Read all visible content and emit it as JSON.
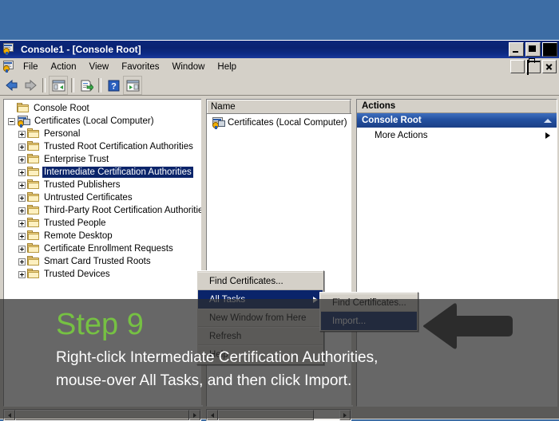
{
  "desktop": {
    "background_color": "#3d6da5"
  },
  "window": {
    "title": "Console1 - [Console Root]",
    "icon": "mmc-console-icon",
    "buttons": {
      "minimize": "Minimize",
      "maximize": "Maximize",
      "close": "Close"
    },
    "mdi_buttons": {
      "minimize": "Minimize",
      "restore": "Restore",
      "close": "Close"
    }
  },
  "menubar": {
    "icon": "mmc-console-icon",
    "items": [
      {
        "label": "File"
      },
      {
        "label": "Action"
      },
      {
        "label": "View"
      },
      {
        "label": "Favorites"
      },
      {
        "label": "Window"
      },
      {
        "label": "Help"
      }
    ]
  },
  "toolbar": {
    "items": [
      {
        "name": "back-button",
        "icon": "arrow-left-icon"
      },
      {
        "name": "forward-button",
        "icon": "arrow-right-icon"
      },
      {
        "name": "show-hide-tree-button",
        "icon": "console-tree-icon"
      },
      {
        "name": "export-list-button",
        "icon": "export-list-icon"
      },
      {
        "name": "help-button",
        "icon": "question-mark-icon"
      },
      {
        "name": "show-action-pane-button",
        "icon": "action-pane-icon"
      }
    ]
  },
  "tree": {
    "root": {
      "label": "Console Root",
      "icon": "folder-icon"
    },
    "node": {
      "label": "Certificates (Local Computer)",
      "icon": "certificate-computer-icon",
      "expander": "minus"
    },
    "children": [
      {
        "label": "Personal"
      },
      {
        "label": "Trusted Root Certification Authorities"
      },
      {
        "label": "Enterprise Trust"
      },
      {
        "label": "Intermediate Certification Authorities",
        "selected": true
      },
      {
        "label": "Trusted Publishers"
      },
      {
        "label": "Untrusted Certificates"
      },
      {
        "label": "Third-Party Root Certification Authorities"
      },
      {
        "label": "Trusted People"
      },
      {
        "label": "Remote Desktop"
      },
      {
        "label": "Certificate Enrollment Requests"
      },
      {
        "label": "Smart Card Trusted Roots"
      },
      {
        "label": "Trusted Devices"
      }
    ]
  },
  "list": {
    "columns": [
      "Name"
    ],
    "rows": [
      {
        "name": "Certificates (Local Computer)",
        "icon": "certificate-computer-icon"
      }
    ]
  },
  "actions": {
    "header": "Actions",
    "group": {
      "label": "Console Root",
      "collapse_icon": "chevron-up-icon"
    },
    "items": [
      {
        "label": "More Actions",
        "submenu_icon": "chevron-right-icon"
      }
    ]
  },
  "context_menu": {
    "items": [
      {
        "label": "Find Certificates...",
        "highlighted": false,
        "has_submenu": false
      },
      {
        "label": "All Tasks",
        "highlighted": true,
        "has_submenu": true
      },
      {
        "label": "New Window from Here",
        "highlighted": false,
        "has_submenu": false
      },
      {
        "label": "Refresh",
        "highlighted": false,
        "has_submenu": false
      },
      {
        "label": "Help",
        "highlighted": false,
        "has_submenu": false
      }
    ],
    "submenu": {
      "items": [
        {
          "label": "Find Certificates...",
          "highlighted": false
        },
        {
          "label": "Import...",
          "highlighted": true
        }
      ]
    }
  },
  "annotation": {
    "arrow": "arrow-left-pointer",
    "arrow_color": "#2b2b2b",
    "arrow_outline_color": "#ffffff"
  },
  "caption": {
    "step_label": "Step 9",
    "step_color": "#76c143",
    "line1": "Right-click Intermediate Certification Authorities,",
    "line2": "mouse-over All Tasks, and then click Import.",
    "background_color": "rgba(45,45,45,0.72)"
  },
  "scrollbars": {
    "tree": {
      "left_arrow": "◀",
      "right_arrow": "▶"
    },
    "list": {
      "left_arrow": "◀",
      "right_arrow": "▶"
    }
  }
}
